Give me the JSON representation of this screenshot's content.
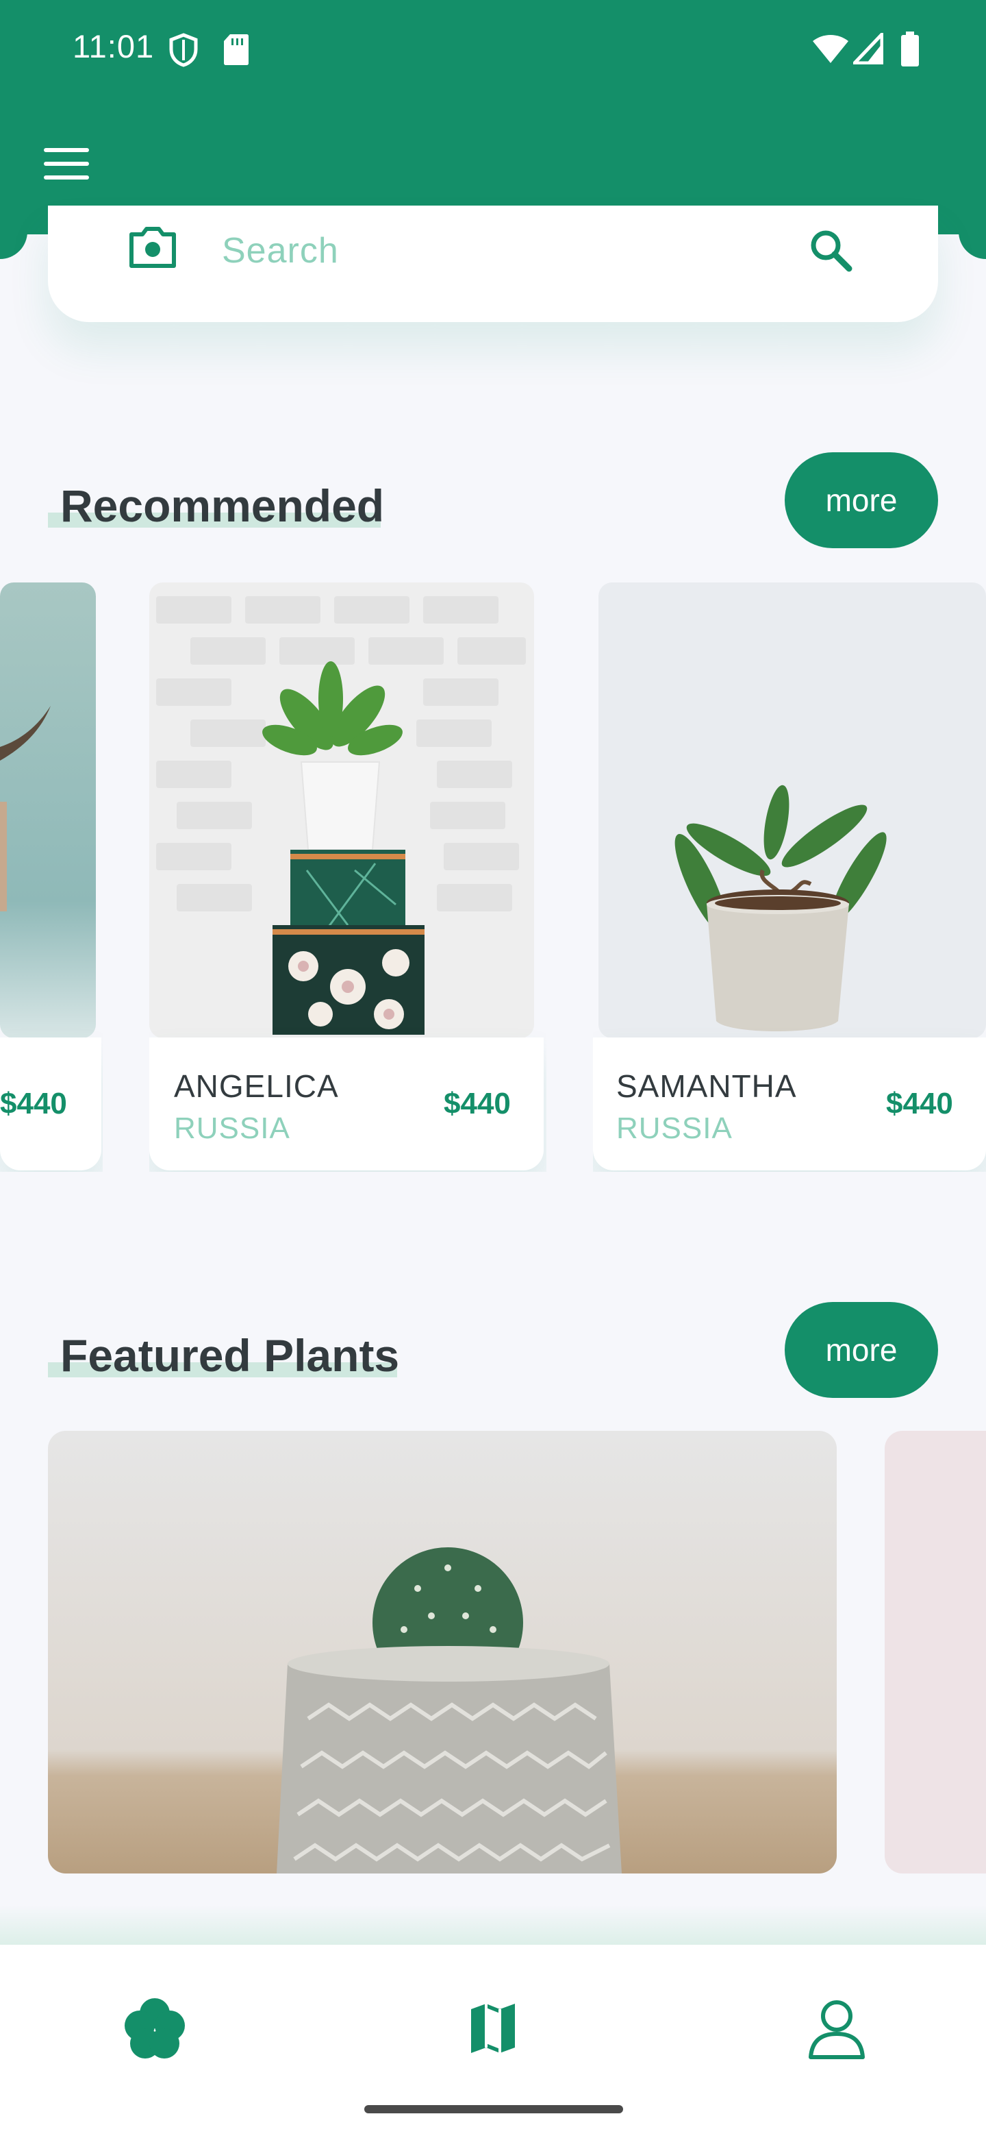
{
  "status_bar": {
    "time": "11:01",
    "icons": [
      "shield-icon",
      "sd-card-icon",
      "wifi-icon",
      "signal-icon",
      "battery-icon"
    ]
  },
  "app_bar": {
    "menu_icon": "menu-icon"
  },
  "search": {
    "placeholder": "Search",
    "camera_icon": "camera-icon",
    "search_icon": "search-icon"
  },
  "recommended": {
    "title": "Recommended",
    "more_label": "more",
    "items": [
      {
        "name": "",
        "country": "",
        "price": "$440"
      },
      {
        "name": "ANGELICA",
        "country": "RUSSIA",
        "price": "$440"
      },
      {
        "name": "SAMANTHA",
        "country": "RUSSIA",
        "price": "$440"
      }
    ]
  },
  "featured": {
    "title": "Featured Plants",
    "more_label": "more"
  },
  "bottom_nav": {
    "items": [
      {
        "icon": "flower-icon"
      },
      {
        "icon": "map-icon"
      },
      {
        "icon": "profile-icon"
      }
    ]
  },
  "colors": {
    "primary": "#148f69",
    "accent_light": "#8ed1bb",
    "background": "#f6f7fb",
    "text_dark": "#333b3f"
  }
}
